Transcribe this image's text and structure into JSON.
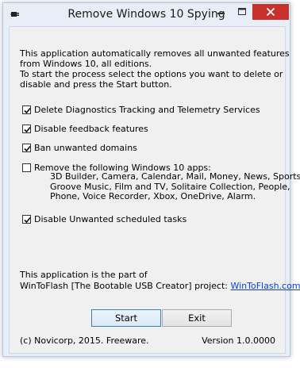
{
  "window": {
    "title": "Remove Windows 10 Spying"
  },
  "caption_buttons": {
    "minimize_icon": "minimize-icon",
    "maximize_icon": "maximize-icon",
    "close_icon": "close-icon",
    "close_color": "#c7312b"
  },
  "description": [
    "This application automatically removes all unwanted features",
    "from Windows 10, all editions.",
    "To start the process select the options you want to delete or",
    "disable and press the Start button."
  ],
  "options": {
    "diagnostics": {
      "label": "Delete Diagnostics Tracking and Telemetry Services",
      "checked": true
    },
    "feedback": {
      "label": "Disable feedback features",
      "checked": true
    },
    "domains": {
      "label": "Ban unwanted domains",
      "checked": true
    },
    "apps": {
      "label": "Remove the following Windows 10 apps:",
      "checked": false,
      "list_lines": [
        "3D Builder, Camera, Calendar, Mail, Money, News, Sports,",
        "Groove Music, Film and TV, Solitaire Collection, People,",
        "Phone, Voice Recorder, Xbox, OneDrive, Alarm."
      ]
    },
    "tasks": {
      "label": "Disable Unwanted scheduled tasks",
      "checked": true
    }
  },
  "footer": {
    "line1": "This application is the part of",
    "line2_text": "WinToFlash [The Bootable USB Creator] project:",
    "link": "WinToFlash.com"
  },
  "buttons": {
    "start": "Start",
    "exit": "Exit"
  },
  "status": {
    "copyright": "(c) Novicorp, 2015. Freeware.",
    "version": "Version 1.0.0000"
  }
}
